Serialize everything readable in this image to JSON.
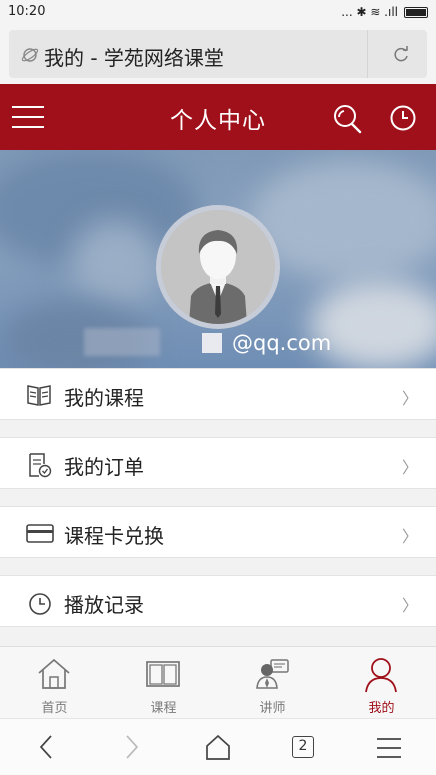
{
  "status_bar": {
    "time": "10:20",
    "indicators": "... ✱ ≋ .ıll"
  },
  "address_bar": {
    "page_title": "我的 - 学苑网络课堂"
  },
  "header": {
    "title": "个人中心"
  },
  "profile": {
    "email_suffix": "@qq.com"
  },
  "menu": {
    "items": [
      {
        "label": "我的课程",
        "icon": "book-icon"
      },
      {
        "label": "我的订单",
        "icon": "order-icon"
      },
      {
        "label": "课程卡兑换",
        "icon": "card-icon"
      },
      {
        "label": "播放记录",
        "icon": "clock-icon"
      }
    ],
    "chevron": "〉"
  },
  "tabs": [
    {
      "label": "首页",
      "icon": "home-icon"
    },
    {
      "label": "课程",
      "icon": "open-book-icon"
    },
    {
      "label": "讲师",
      "icon": "teacher-icon"
    },
    {
      "label": "我的",
      "icon": "person-icon",
      "active": true
    }
  ],
  "browser_nav": {
    "tab_count": "2"
  },
  "colors": {
    "brand_red": "#a0101a",
    "banner_blue": "#7f99b7"
  }
}
